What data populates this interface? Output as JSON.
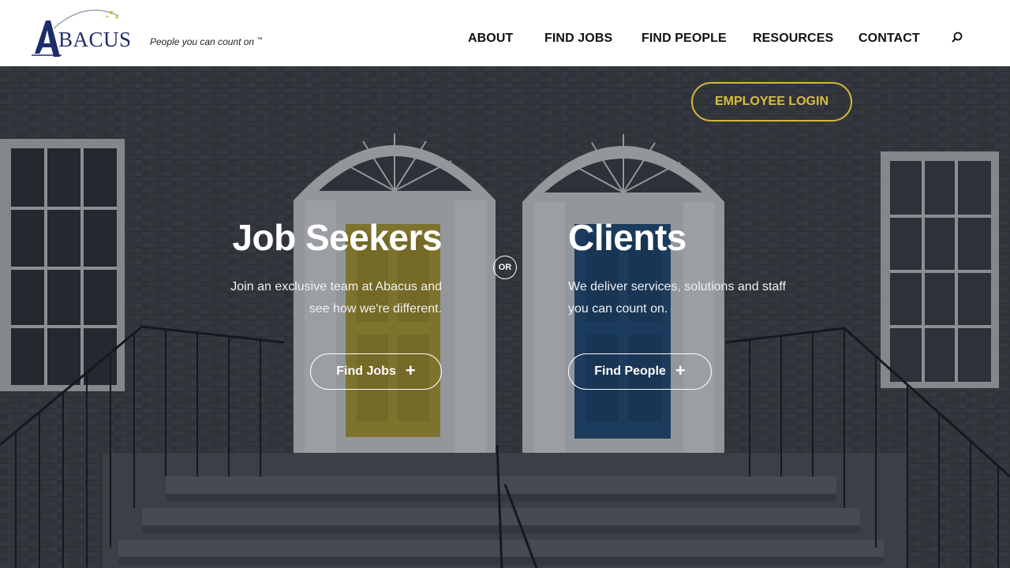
{
  "brand": {
    "logo_text": "ABACUS",
    "tagline": "People you can count on",
    "tagline_mark": "™",
    "colors": {
      "navy": "#1d2d6b",
      "gold": "#d4b63c"
    }
  },
  "nav": {
    "items": [
      {
        "label": "ABOUT"
      },
      {
        "label": "FIND JOBS"
      },
      {
        "label": "FIND PEOPLE"
      },
      {
        "label": "RESOURCES"
      },
      {
        "label": "CONTACT"
      }
    ],
    "search_icon": "search-icon"
  },
  "hero": {
    "employee_login": "EMPLOYEE LOGIN",
    "or_label": "OR",
    "left": {
      "title": "Job Seekers",
      "line1": "Join an exclusive team at Abacus and",
      "line2": "see how we're different.",
      "button": "Find Jobs",
      "button_icon": "plus-icon"
    },
    "right": {
      "title": "Clients",
      "line1": "We deliver services, solutions and staff",
      "line2": "you can count on.",
      "button": "Find People",
      "button_icon": "plus-icon"
    }
  }
}
